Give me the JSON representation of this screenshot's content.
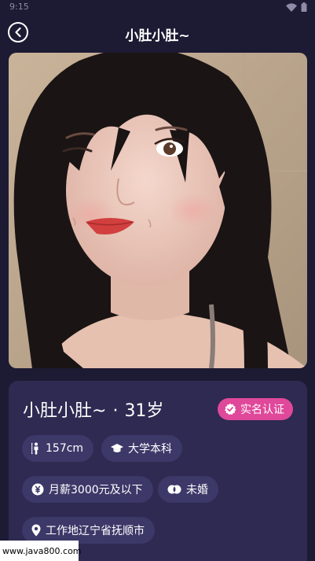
{
  "status_bar": {
    "time": "9:15"
  },
  "header": {
    "title": "小肚小肚~"
  },
  "profile": {
    "name": "小肚小肚~",
    "separator": "·",
    "age": "31岁",
    "verify_label": "实名认证"
  },
  "tags": {
    "height": "157cm",
    "education": "大学本科",
    "salary": "月薪3000元及以下",
    "marital": "未婚",
    "work_location": "工作地辽宁省抚顺市"
  },
  "watermark": "www.java800.com",
  "colors": {
    "background": "#1d1a33",
    "card": "#2e2a52",
    "tag": "#3c3868",
    "accent": "#e0489a"
  }
}
